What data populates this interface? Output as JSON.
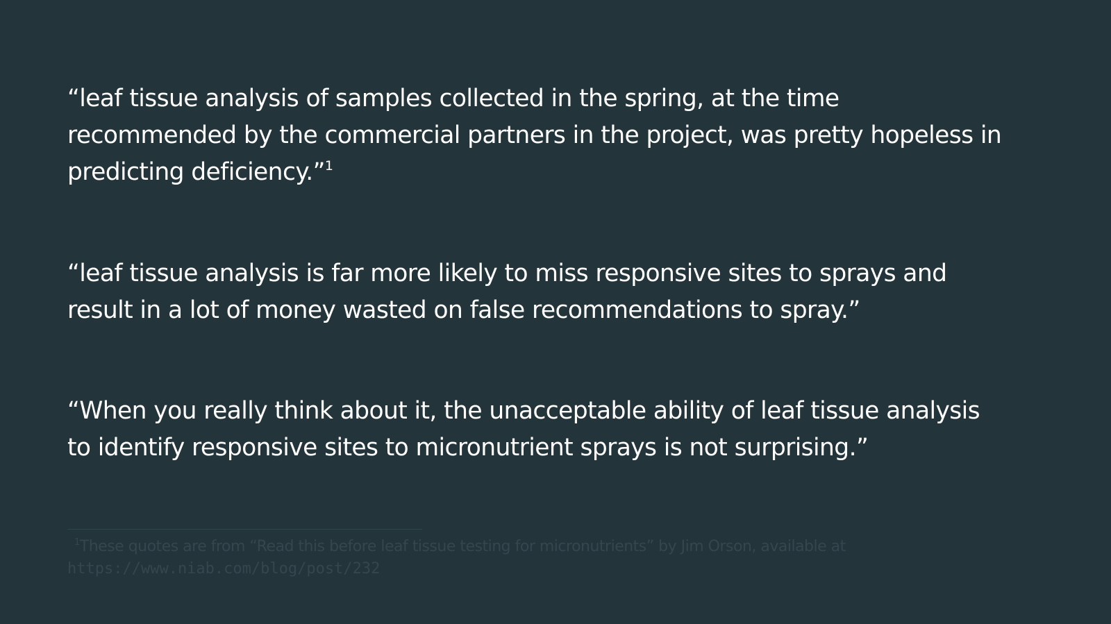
{
  "quotes": [
    {
      "lines": [
        "“leaf tissue analysis of samples collected in the spring, at the time",
        "recommended by the commercial partners in the project, was pretty hopeless in",
        "predicting deficiency.”"
      ],
      "footnote_ref": "1"
    },
    {
      "lines": [
        "“leaf tissue analysis is far more likely to miss responsive sites to sprays and",
        "result in a lot of money wasted on false recommendations to spray.”"
      ]
    },
    {
      "lines": [
        "“When you really think about it, the unacceptable ability of leaf tissue analysis",
        "to identify responsive sites to micronutrient sprays is not surprising.”"
      ]
    }
  ],
  "footnote": {
    "mark": "1",
    "text": "These quotes are from “Read this before leaf tissue testing for micronutrients” by Jim Orson, available at",
    "url": "https://www.niab.com/blog/post/232"
  },
  "colors": {
    "background": "#23343a",
    "text": "#ffffff",
    "footnote_text": "#34474e",
    "footnote_rule": "#2f444b"
  }
}
